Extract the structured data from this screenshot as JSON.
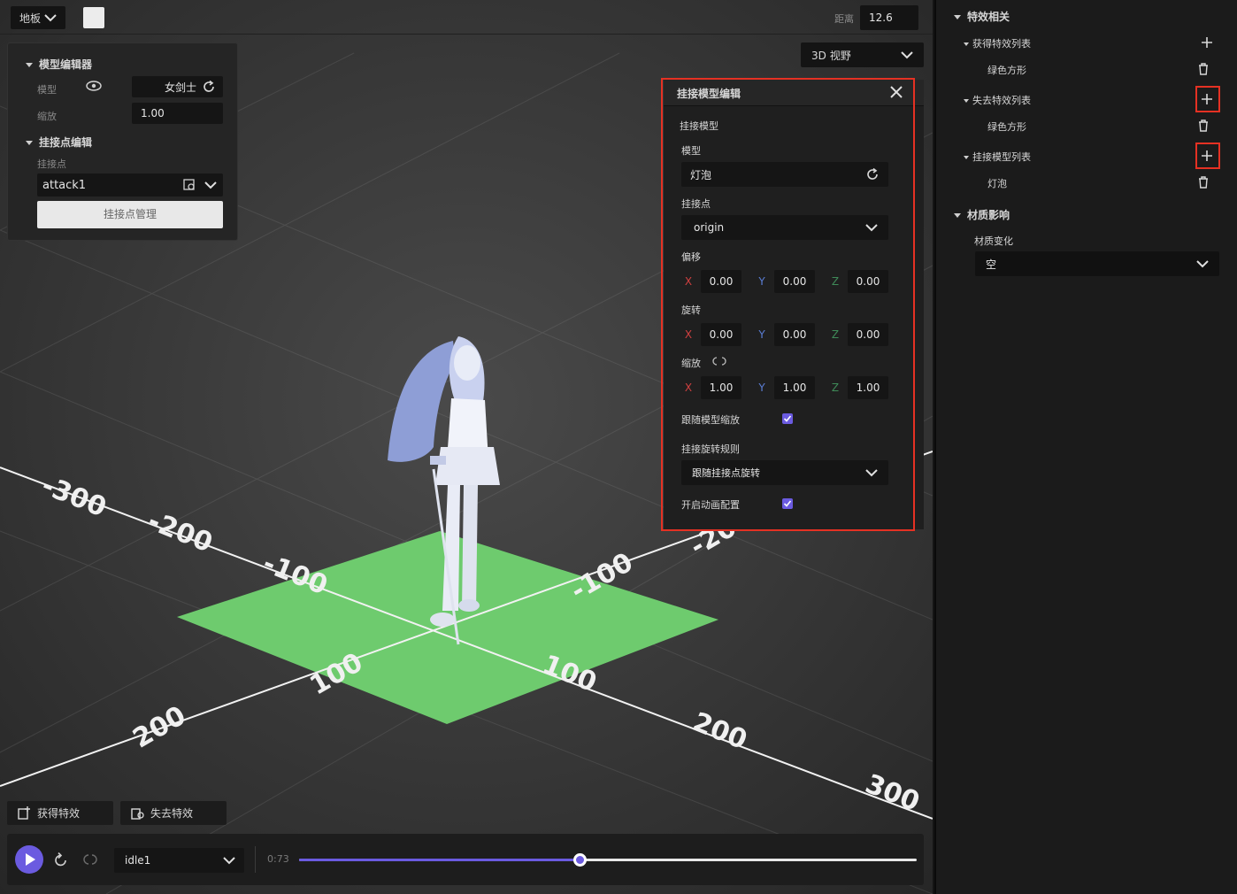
{
  "top_bar": {
    "floor_dropdown": "地板",
    "distance_label": "距离",
    "distance_value": "12.6"
  },
  "view_mode": {
    "label": "3D 视野"
  },
  "model_editor": {
    "section_title": "模型编辑器",
    "model_label": "模型",
    "model_value": "女剑士",
    "scale_label": "缩放",
    "scale_value": "1.00",
    "attach_section_title": "挂接点编辑",
    "attach_point_label": "挂接点",
    "attach_point_value": "attack1",
    "manage_button": "挂接点管理"
  },
  "attach_dialog": {
    "title": "挂接模型编辑",
    "section_label": "挂接模型",
    "model_label": "模型",
    "model_value": "灯泡",
    "attach_point_label": "挂接点",
    "attach_point_value": "origin",
    "offset_label": "偏移",
    "offset": {
      "x": "0.00",
      "y": "0.00",
      "z": "0.00"
    },
    "rotation_label": "旋转",
    "rotation": {
      "x": "0.00",
      "y": "0.00",
      "z": "0.00"
    },
    "scale_label": "缩放",
    "scale": {
      "x": "1.00",
      "y": "1.00",
      "z": "1.00"
    },
    "axis_x": "X",
    "axis_y": "Y",
    "axis_z": "Z",
    "follow_scale_label": "跟随模型缩放",
    "follow_scale_checked": true,
    "rotation_rule_label": "挂接旋转规则",
    "rotation_rule_value": "跟随挂接点旋转",
    "enable_anim_label": "开启动画配置",
    "enable_anim_checked": true
  },
  "effect_buttons": {
    "gain": "获得特效",
    "lose": "失去特效"
  },
  "playback": {
    "animation": "idle1",
    "time": "0:73",
    "progress": 0.455
  },
  "grid_labels": [
    "-300",
    "-200",
    "-100",
    "100",
    "200",
    "-100",
    "100",
    "200",
    "300",
    "-200"
  ],
  "sidebar": {
    "effects_title": "特效相关",
    "gain_list_title": "获得特效列表",
    "gain_item": "绿色方形",
    "lose_list_title": "失去特效列表",
    "lose_item": "绿色方形",
    "attach_list_title": "挂接模型列表",
    "attach_item": "灯泡",
    "material_title": "材质影响",
    "material_change_label": "材质变化",
    "material_value": "空"
  },
  "colors": {
    "accent": "#6b5be0",
    "highlight": "#e53123",
    "floor_green": "#6ecb6e"
  }
}
